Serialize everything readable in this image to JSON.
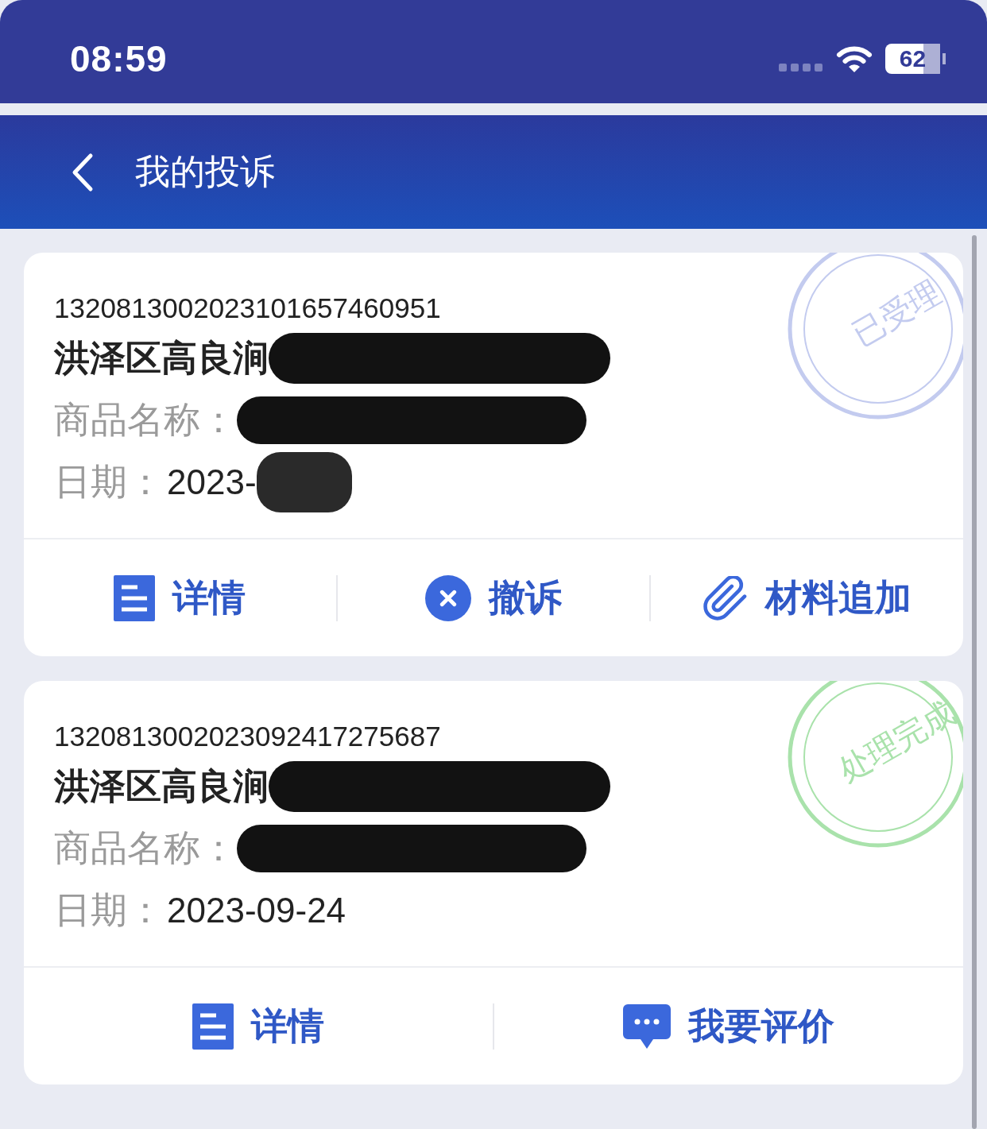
{
  "status_bar": {
    "time": "08:59",
    "battery": "62"
  },
  "nav": {
    "title": "我的投诉"
  },
  "complaints": [
    {
      "number": "1320813002023101657460951",
      "merchant": {
        "text": "洪泽区高良涧",
        "redacted": true
      },
      "product": {
        "label": "商品名称：",
        "redacted": true
      },
      "date": {
        "label": "日期：",
        "value": "2023-",
        "redacted": true
      },
      "status": {
        "text": "已受理",
        "color": "#c3cbef"
      },
      "actions": [
        {
          "kind": "details",
          "label": "详情"
        },
        {
          "kind": "withdraw",
          "label": "撤诉"
        },
        {
          "kind": "attach",
          "label": "材料追加"
        }
      ]
    },
    {
      "number": "1320813002023092417275687",
      "merchant": {
        "text": "洪泽区高良涧",
        "redacted": true
      },
      "product": {
        "label": "商品名称：",
        "redacted": true
      },
      "date": {
        "label": "日期：",
        "value": "2023-09-24",
        "redacted": false
      },
      "status": {
        "text": "处理完成",
        "color": "#a9e2ab"
      },
      "actions": [
        {
          "kind": "details",
          "label": "详情"
        },
        {
          "kind": "review",
          "label": "我要评价"
        }
      ]
    }
  ]
}
